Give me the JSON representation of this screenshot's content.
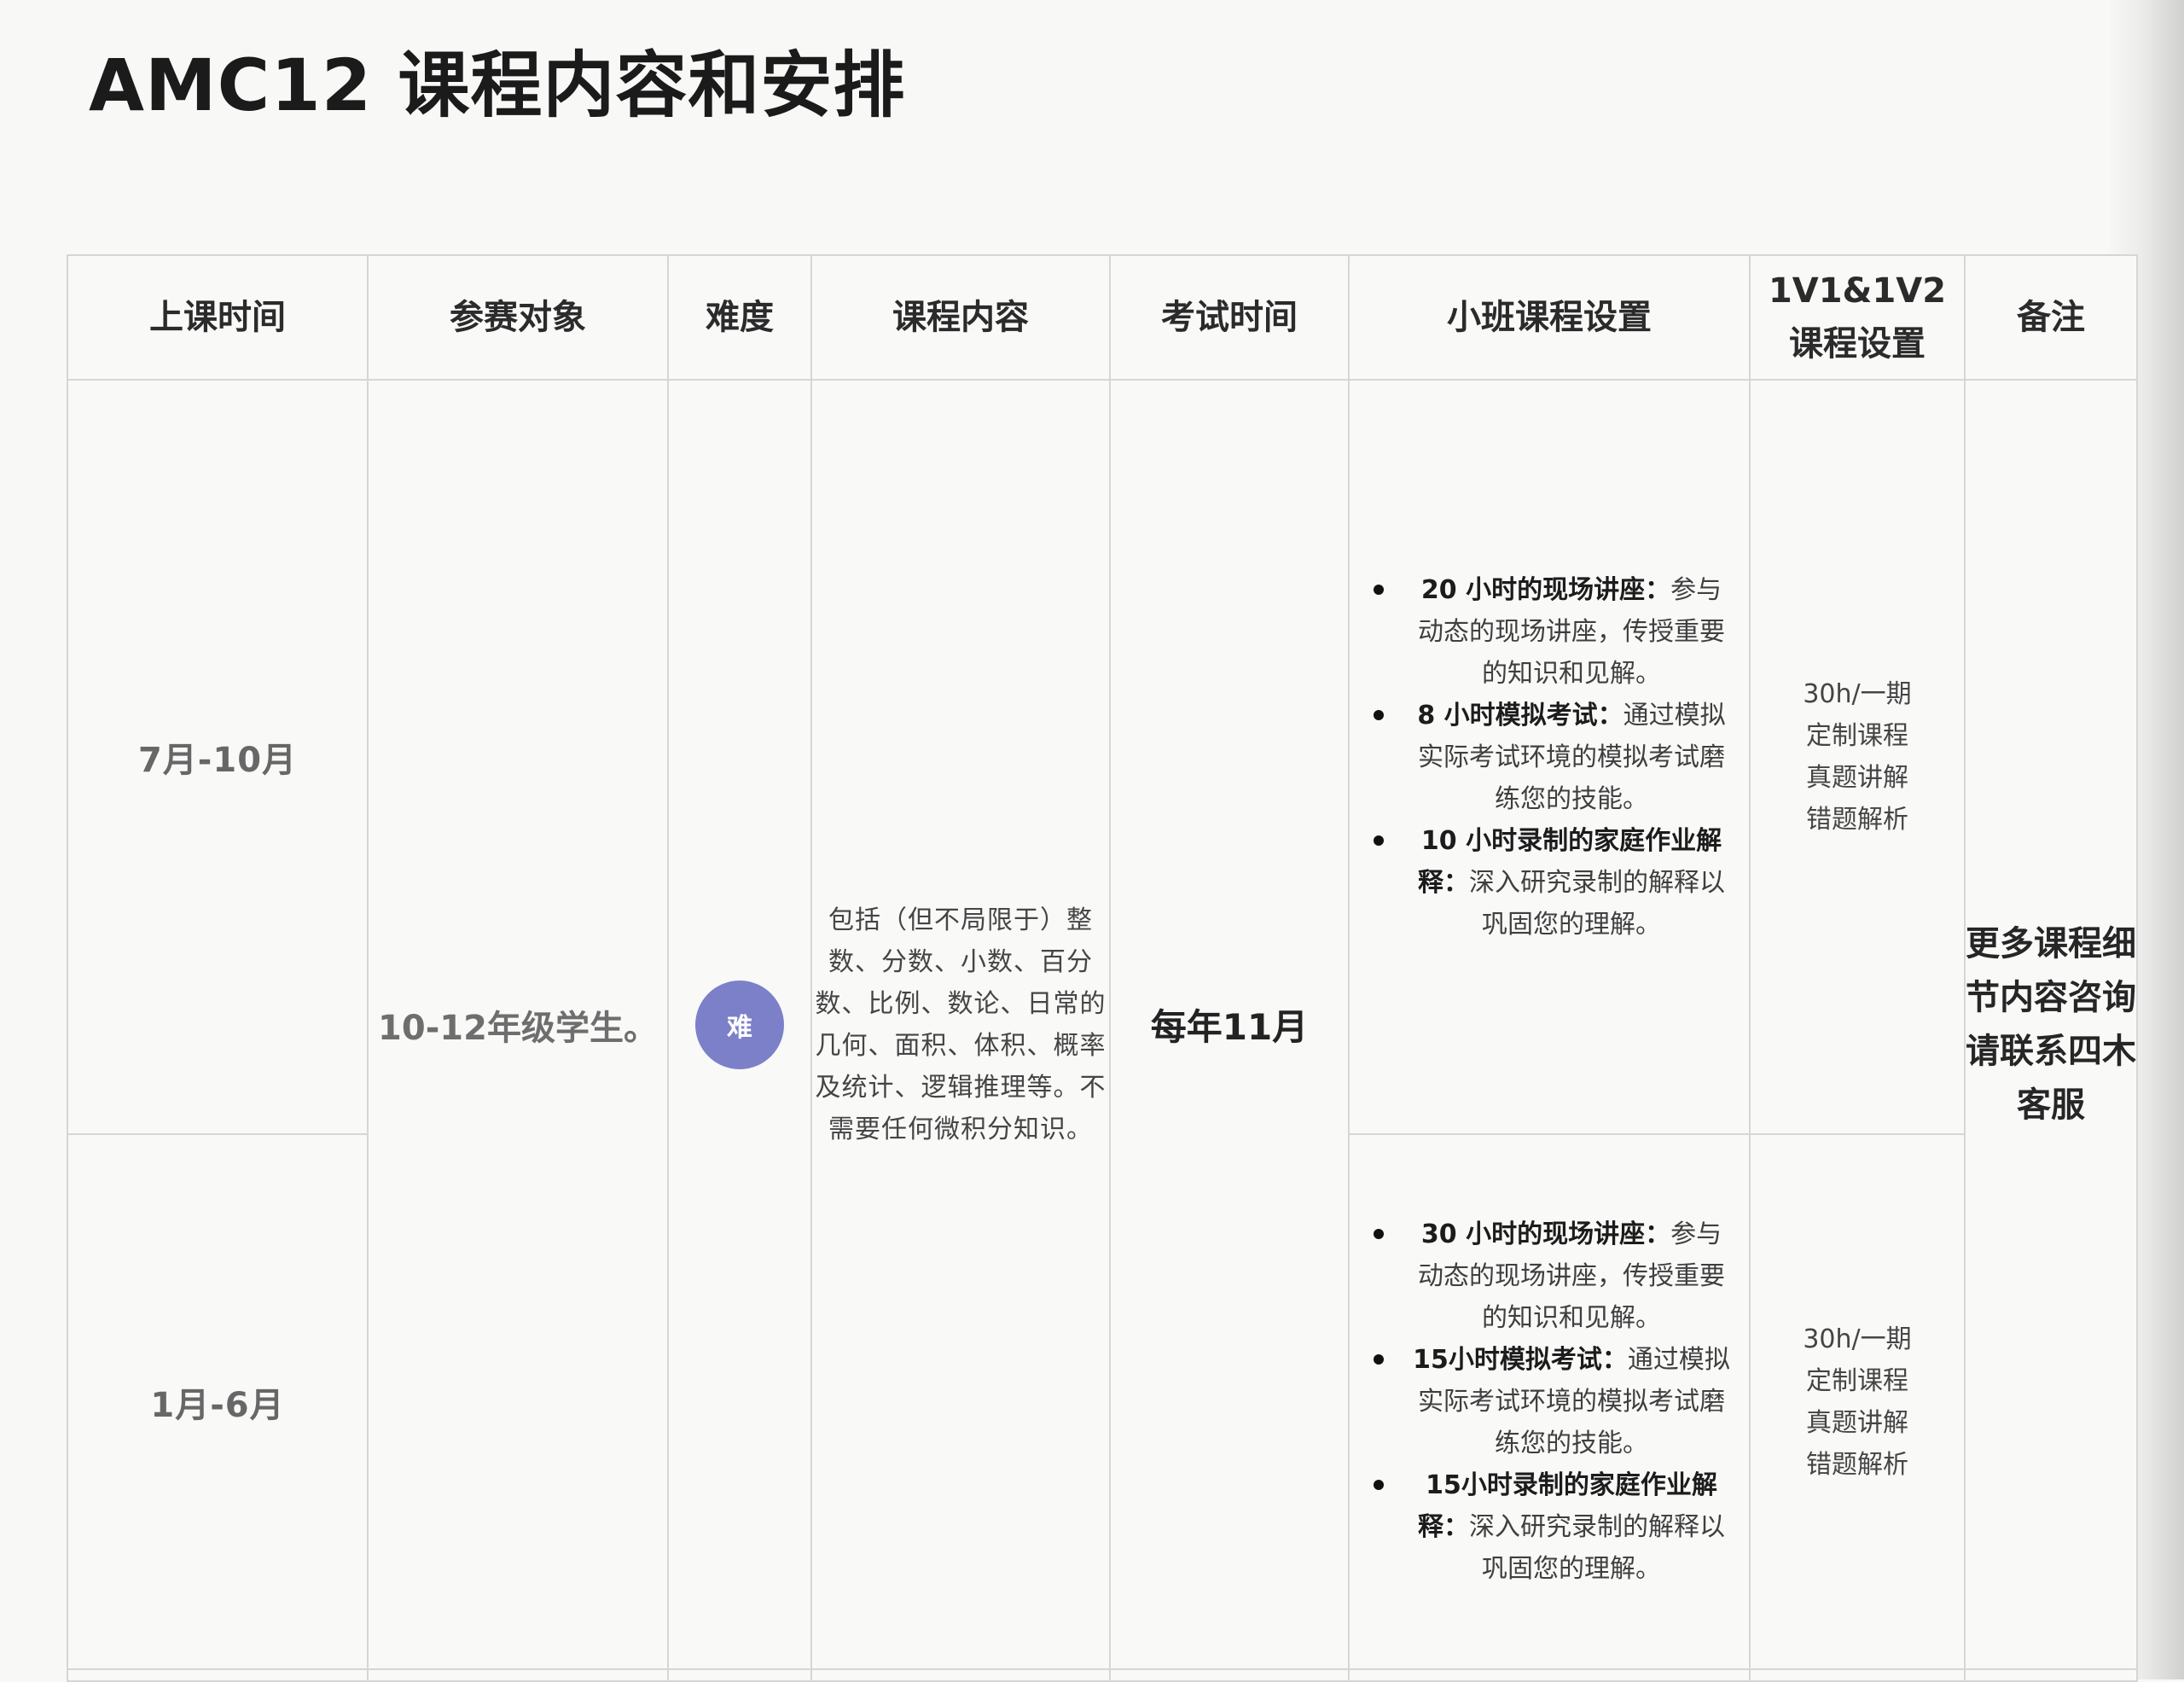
{
  "page": {
    "title": "AMC12 课程内容和安排"
  },
  "table": {
    "headers": {
      "time": "上课时间",
      "audience": "参赛对象",
      "difficulty": "难度",
      "content": "课程内容",
      "exam": "考试时间",
      "small_class": "小班课程设置",
      "vip_line1": "1V1&1V2",
      "vip_line2": "课程设置",
      "remark": "备注"
    },
    "rows": [
      {
        "period": "7月-10月",
        "small_class": [
          {
            "bold": "20 小时的现场讲座：",
            "text": "参与动态的现场讲座，传授重要的知识和见解。"
          },
          {
            "bold": "8 小时模拟考试：",
            "text": "通过模拟实际考试环境的模拟考试磨练您的技能。"
          },
          {
            "bold": "10 小时录制的家庭作业解释：",
            "text": "深入研究录制的解释以巩固您的理解。"
          }
        ],
        "vip": [
          "30h/一期",
          "定制课程",
          "真题讲解",
          "错题解析"
        ]
      },
      {
        "period": "1月-6月",
        "small_class": [
          {
            "bold": "30 小时的现场讲座：",
            "text": "参与动态的现场讲座，传授重要的知识和见解。"
          },
          {
            "bold": "15小时模拟考试：",
            "text": "通过模拟实际考试环境的模拟考试磨练您的技能。"
          },
          {
            "bold": "15小时录制的家庭作业解释：",
            "text": "深入研究录制的解释以巩固您的理解。"
          }
        ],
        "vip": [
          "30h/一期",
          "定制课程",
          "真题讲解",
          "错题解析"
        ]
      }
    ],
    "shared": {
      "audience": "10-12年级学生。",
      "difficulty_badge": "难",
      "content": "包括（但不局限于）整数、分数、小数、百分数、比例、数论、日常的几何、面积、体积、概率及统计、逻辑推理等。不需要任何微积分知识。",
      "exam_time": "每年11月",
      "remark": "更多课程细节内容咨询请联系四木客服"
    }
  },
  "colors": {
    "badge": "#7b80c9",
    "border": "#d6d6d6",
    "background": "#f8f8f7"
  }
}
